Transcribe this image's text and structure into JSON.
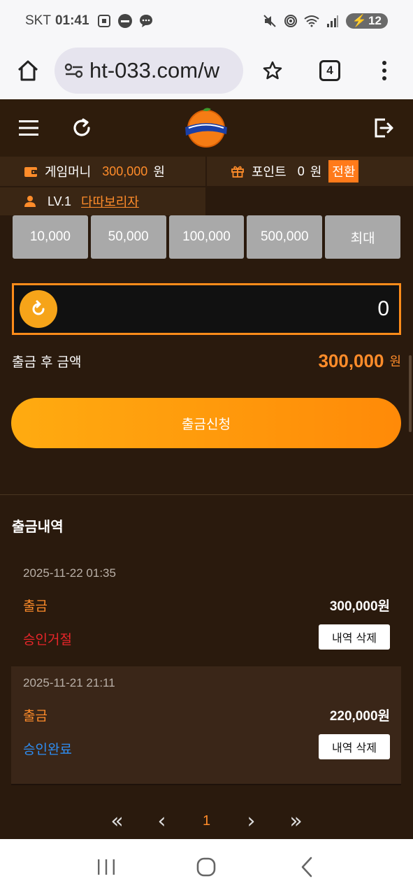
{
  "status_bar": {
    "carrier": "SKT",
    "time": "01:41",
    "battery": "12",
    "notification_icons": [
      "screenshot-icon",
      "coupang-eats-icon",
      "message-icon"
    ],
    "system_icons": [
      "mute-icon",
      "hotspot-icon",
      "wifi-icon",
      "signal-icon"
    ]
  },
  "browser": {
    "url": "ht-033.com/w",
    "tab_count": "4"
  },
  "header": {
    "logo_alt": "Fanta"
  },
  "user": {
    "money_label": "게임머니",
    "money_value": "300,000",
    "money_unit": "원",
    "point_label": "포인트",
    "point_value": "0",
    "point_unit": "원",
    "convert_label": "전환",
    "level": "LV.1",
    "nickname": "다따보리자"
  },
  "quick_amounts": [
    "10,000",
    "50,000",
    "100,000",
    "500,000",
    "최대"
  ],
  "withdraw": {
    "input_value": "0",
    "after_label": "출금 후 금액",
    "after_value": "300,000",
    "after_unit": "원",
    "submit_label": "출금신청"
  },
  "history": {
    "title": "출금내역",
    "items": [
      {
        "date": "2025-11-22 01:35",
        "type": "출금",
        "amount": "300,000원",
        "status": "승인거절",
        "delete_label": "내역 삭제"
      },
      {
        "date": "2025-11-21 21:11",
        "type": "출금",
        "amount": "220,000원",
        "status": "승인완료",
        "delete_label": "내역 삭제"
      }
    ]
  },
  "pagination": {
    "first": "«",
    "prev": "‹",
    "current": "1",
    "next": "›",
    "last": "»"
  },
  "colors": {
    "accent": "#ff8c2a",
    "background": "#2a1a0d",
    "reject": "#e8262a",
    "approved": "#2e8df2"
  }
}
